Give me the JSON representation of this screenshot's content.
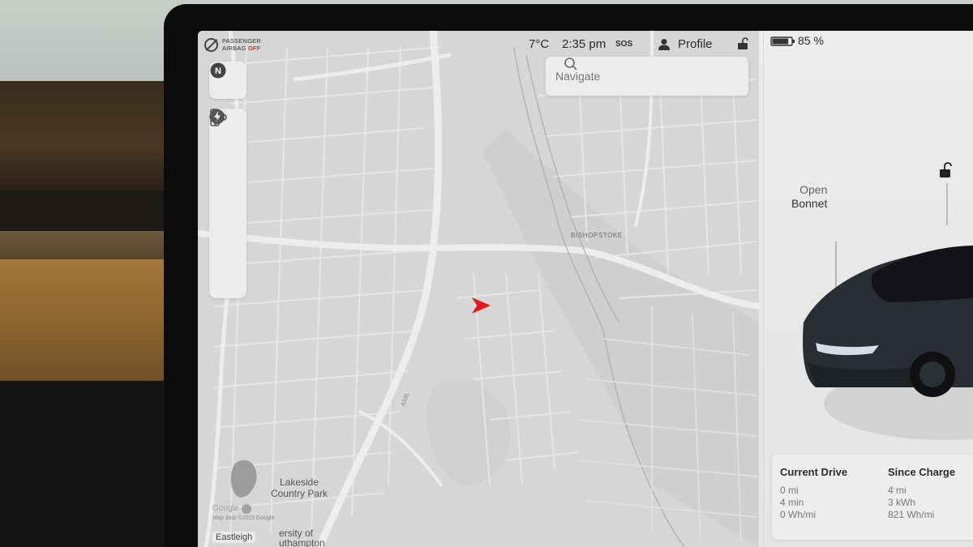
{
  "status_bar": {
    "airbag_line1": "PASSENGER",
    "airbag_line2": "AIRBAG",
    "airbag_state": "OFF",
    "temperature": "7°C",
    "time": "2:35 pm",
    "sos": "SOS",
    "profile_label": "Profile",
    "battery_percent": "85 %",
    "battery_level": 0.85
  },
  "search": {
    "placeholder": "Navigate"
  },
  "map_toolbar": {
    "compass_icon": "compass-north-icon",
    "tools": [
      "globe-icon",
      "traffic-light-icon",
      "map-pin-icon",
      "lightning-bolt-icon",
      "cloud-icon"
    ]
  },
  "map": {
    "labels": {
      "bishopstoke": "BISHOPSTOKE",
      "lakeside_line1": "Lakeside",
      "lakeside_line2": "Country Park",
      "road": "A335",
      "eastleigh": "Eastleigh",
      "university_line1": "ersity of",
      "university_line2": "uthampton"
    },
    "attribution_logo": "Google",
    "attribution_text": "Map data ©2023 Google",
    "vehicle_marker_color": "#e11b1b"
  },
  "vehicle": {
    "bonnet_action": "Open",
    "bonnet_label": "Bonnet",
    "lock_icon": "unlocked-padlock-icon"
  },
  "trip_stats": {
    "current_drive": {
      "title": "Current Drive",
      "distance": "0 mi",
      "duration": "4 min",
      "efficiency": "0 Wh/mi"
    },
    "since_charge": {
      "title": "Since Charge",
      "distance": "4 mi",
      "energy": "3 kWh",
      "efficiency": "821 Wh/mi"
    }
  }
}
